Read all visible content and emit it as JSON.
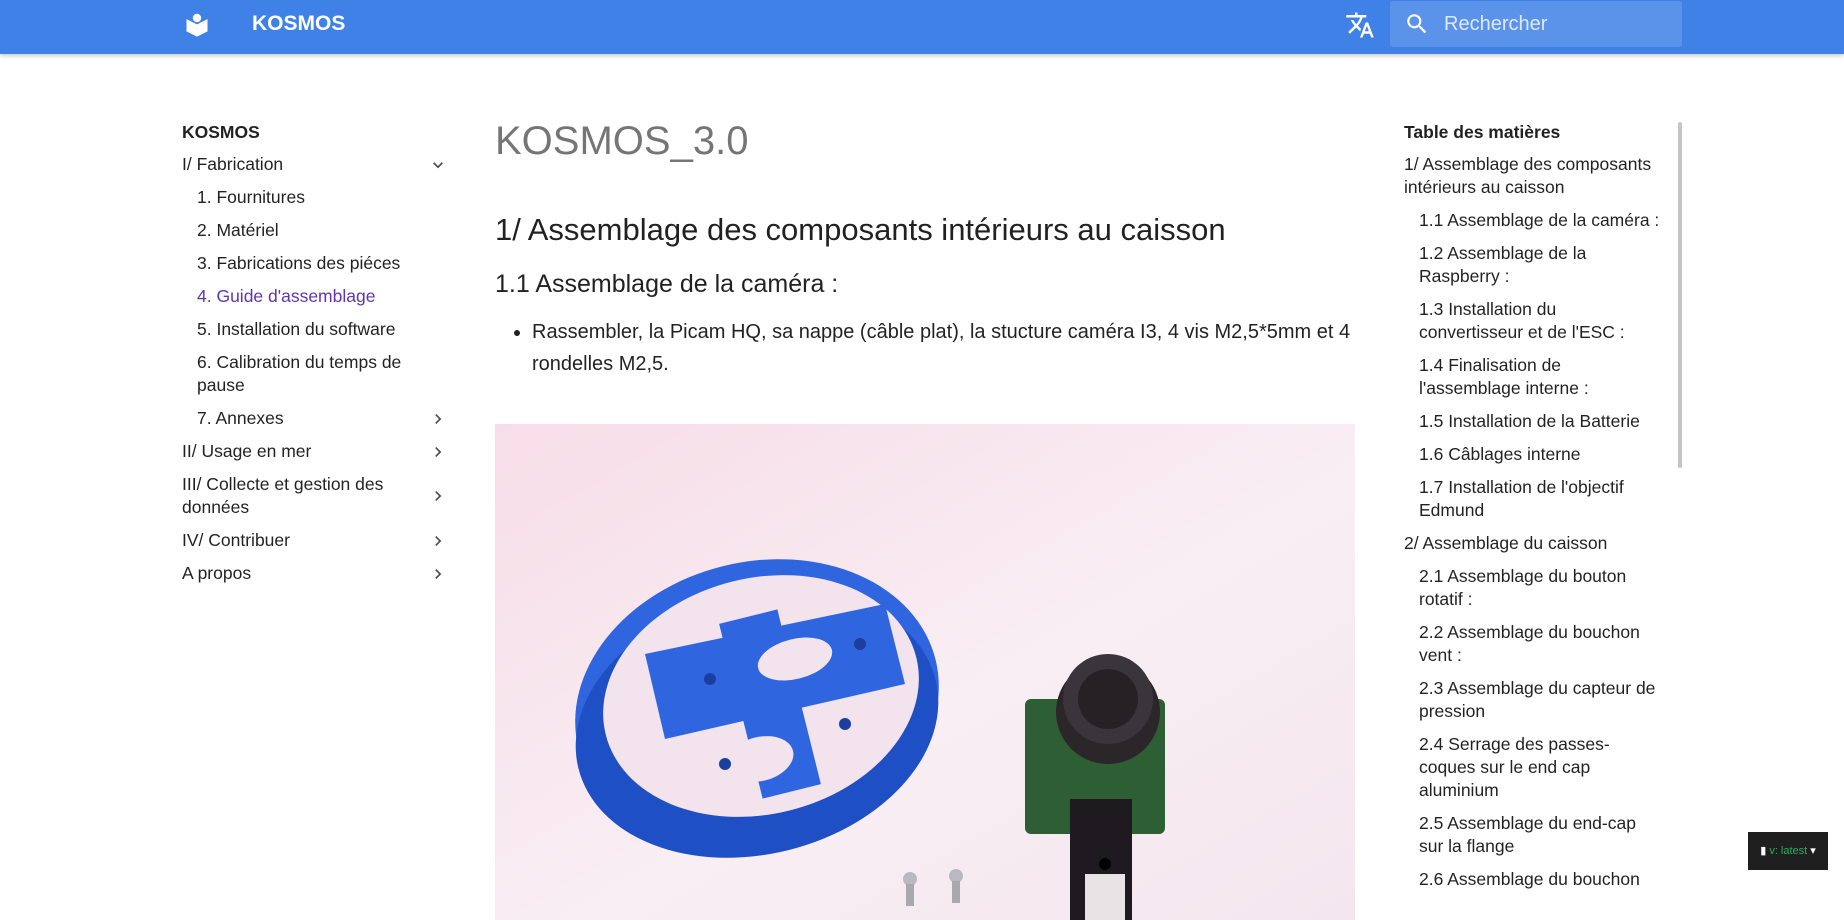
{
  "header": {
    "title": "KOSMOS",
    "search_placeholder": "Rechercher"
  },
  "nav": {
    "title": "KOSMOS",
    "items": [
      {
        "label": "I/ Fabrication",
        "level": 0,
        "chevron": "chevron-down-icon"
      },
      {
        "label": "1. Fournitures",
        "level": 1
      },
      {
        "label": "2. Matériel",
        "level": 1
      },
      {
        "label": "3. Fabrications des piéces",
        "level": 1
      },
      {
        "label": "4. Guide d'assemblage",
        "level": 1,
        "active": true
      },
      {
        "label": "5. Installation du software",
        "level": 1
      },
      {
        "label": "6. Calibration du temps de pause",
        "level": 1
      },
      {
        "label": "7. Annexes",
        "level": 1,
        "chevron": "chevron-right-icon"
      },
      {
        "label": "II/ Usage en mer",
        "level": 0,
        "chevron": "chevron-right-icon"
      },
      {
        "label": "III/ Collecte et gestion des données",
        "level": 0,
        "chevron": "chevron-right-icon"
      },
      {
        "label": "IV/ Contribuer",
        "level": 0,
        "chevron": "chevron-right-icon"
      },
      {
        "label": "A propos",
        "level": 0,
        "chevron": "chevron-right-icon"
      }
    ]
  },
  "content": {
    "h1": "KOSMOS_3.0",
    "h2": "1/ Assemblage des composants intérieurs au caisson",
    "h3": "1.1 Assemblage de la caméra :",
    "bullet": "Rassembler, la Picam HQ, sa nappe (câble plat), la stucture caméra I3, 4 vis M2,5*5mm et 4 rondelles M2,5."
  },
  "toc": {
    "title": "Table des matières",
    "items": [
      {
        "label": "1/ Assemblage des composants intérieurs au caisson",
        "level": 0
      },
      {
        "label": "1.1 Assemblage de la caméra :",
        "level": 1
      },
      {
        "label": "1.2 Assemblage de la Raspberry :",
        "level": 1
      },
      {
        "label": "1.3 Installation du convertisseur et de l'ESC :",
        "level": 1
      },
      {
        "label": "1.4 Finalisation de l'assemblage interne :",
        "level": 1
      },
      {
        "label": "1.5 Installation de la Batterie",
        "level": 1
      },
      {
        "label": "1.6 Câblages interne",
        "level": 1
      },
      {
        "label": "1.7 Installation de l'objectif Edmund",
        "level": 1
      },
      {
        "label": "2/ Assemblage du caisson",
        "level": 0
      },
      {
        "label": "2.1 Assemblage du bouton rotatif :",
        "level": 1
      },
      {
        "label": "2.2 Assemblage du bouchon vent :",
        "level": 1
      },
      {
        "label": "2.3 Assemblage du capteur de pression",
        "level": 1
      },
      {
        "label": "2.4 Serrage des passes-coques sur le end cap aluminium",
        "level": 1
      },
      {
        "label": "2.5 Assemblage du end-cap sur la flange",
        "level": 1
      },
      {
        "label": "2.6 Assemblage du bouchon",
        "level": 1
      }
    ]
  },
  "rtd": {
    "version": "v: latest"
  },
  "colors": {
    "header": "#4081e8",
    "active": "#5e35b1"
  }
}
